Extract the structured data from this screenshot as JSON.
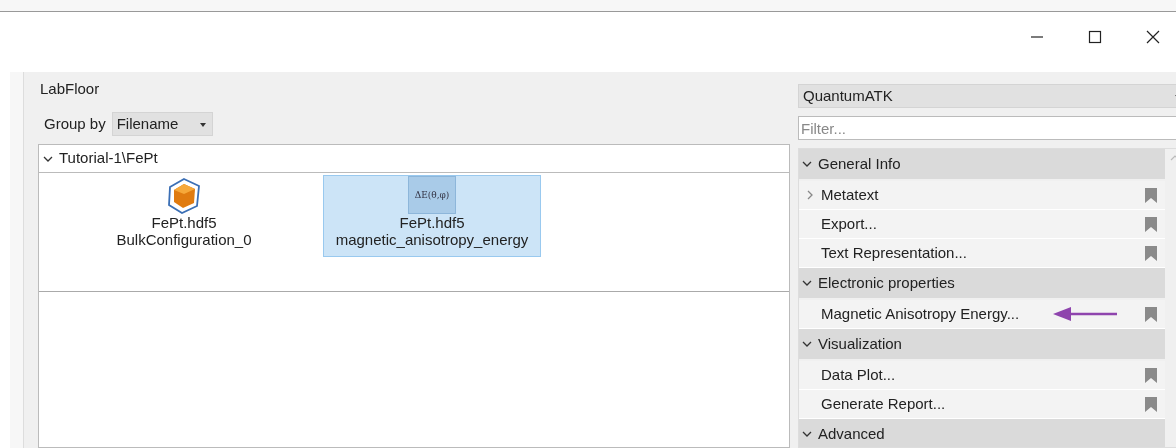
{
  "labfloor": {
    "title": "LabFloor",
    "group_by": {
      "label": "Group by",
      "value": "Filename"
    },
    "groups": [
      {
        "label": "Tutorial-1\\FePt",
        "expanded": true,
        "items": [
          {
            "kind": "configuration",
            "filename": "FePt.hdf5",
            "name": "BulkConfiguration_0",
            "selected": false
          },
          {
            "kind": "analysis",
            "thumbnail_text": "ΔE(θ,φ)",
            "filename": "FePt.hdf5",
            "name": "magnetic_anisotropy_energy",
            "selected": true
          }
        ]
      }
    ]
  },
  "tools": {
    "selector": "QuantumATK",
    "filter": {
      "placeholder": "Filter..."
    },
    "sections": [
      {
        "label": "General Info",
        "expanded": true,
        "items": [
          {
            "label": "Metatext",
            "has_children": true,
            "annotated": false
          },
          {
            "label": "Export...",
            "has_children": false,
            "annotated": false
          },
          {
            "label": "Text Representation...",
            "has_children": false,
            "annotated": false
          }
        ]
      },
      {
        "label": "Electronic properties",
        "expanded": true,
        "items": [
          {
            "label": "Magnetic Anisotropy Energy...",
            "has_children": false,
            "annotated": true
          }
        ]
      },
      {
        "label": "Visualization",
        "expanded": true,
        "items": [
          {
            "label": "Data Plot...",
            "has_children": false,
            "annotated": false
          },
          {
            "label": "Generate Report...",
            "has_children": false,
            "annotated": false
          }
        ]
      },
      {
        "label": "Advanced",
        "expanded": true
      }
    ]
  }
}
